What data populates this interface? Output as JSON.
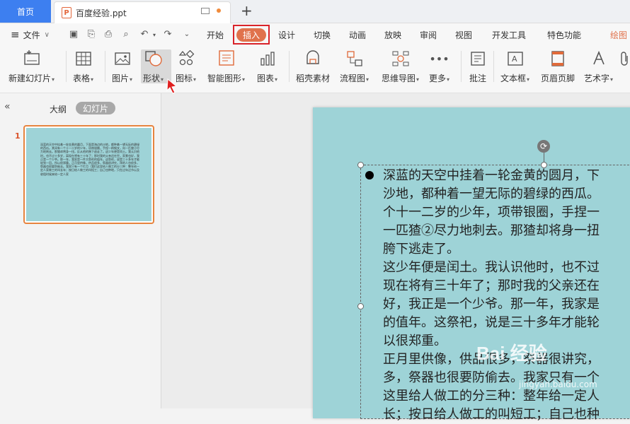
{
  "titlebar": {
    "home_tab": "首页",
    "doc_tab": "百度经验.ppt",
    "doc_icon_letter": "P",
    "new_tab": "+"
  },
  "menu": {
    "hamburger": "≡",
    "file": "文件",
    "items": [
      "开始",
      "插入",
      "设计",
      "切换",
      "动画",
      "放映",
      "审阅",
      "视图",
      "开发工具",
      "特色功能",
      "绘图"
    ],
    "active": "插入",
    "accent": "#e0724c",
    "highlight_color": "#d9232a"
  },
  "ribbon": {
    "new_slide": "新建幻灯片",
    "table": "表格",
    "picture": "图片",
    "shape": "形状",
    "icon": "图标",
    "smart_shape": "智能图形",
    "chart": "图表",
    "material": "稻壳素材",
    "flowchart": "流程图",
    "mindmap": "思维导图",
    "more": "更多",
    "comment": "批注",
    "textbox": "文本框",
    "header_footer": "页眉页脚",
    "wordart": "艺术字"
  },
  "left_panel": {
    "collapse": "«",
    "outline_tab": "大纲",
    "slides_tab": "幻灯片",
    "slide_number": "1",
    "thumb_text": "深蓝的天空中挂着一轮金黄的圆月，下面是海边的沙地，都种着一望无际的碧绿的西瓜。其间有一个十一二岁的少年，项带银圈，手捏一柄钢叉，向一匹猹②尽力地刺去。那猹却将身一扭，反从他的胯下逃走了。这少年便是闰土。我认识他时，也不过十多岁，离现在将有三十年了；那时我的父亲还在世，家景也好，我正是一个少爷。那一年，我家是一件大祭祀的值年。这祭祀，说是三十多年才能轮到一回，所以很郑重。正月里供像，供品很多，祭器很讲究，拜的人也很多，祭器也很要防偷去。我家只有一个忙月（我们这里给人做工的分三种：整年给一定人家做工的叫长年；按日给人做工的叫短工；自己也种地，只在过年过节以及收租时候来给一定人家"
  },
  "slide": {
    "rotate_icon": "⟳",
    "lines": [
      "深蓝的天空中挂着一轮金黄的圆月，下",
      "沙地，都种着一望无际的碧绿的西瓜。",
      "个十一二岁的少年，项带银圈，手捏一",
      "一匹猹②尽力地刺去。那猹却将身一扭",
      "胯下逃走了。",
      "这少年便是闰土。我认识他时，也不过",
      "现在将有三十年了；那时我的父亲还在",
      "好，我正是一个少爷。那一年，我家是",
      "的值年。这祭祀，说是三十多年才能轮",
      "以很郑重。",
      "正月里供像，供品很多，祭器很讲究，",
      "多，祭器也很要防偷去。我家只有一个",
      "这里给人做工的分三种：整年给一定人",
      "长；按日给人做工的叫短工；自己也种"
    ]
  },
  "watermark": {
    "line1": "Bai 经验",
    "line2": "jingyan.baidu.com"
  }
}
